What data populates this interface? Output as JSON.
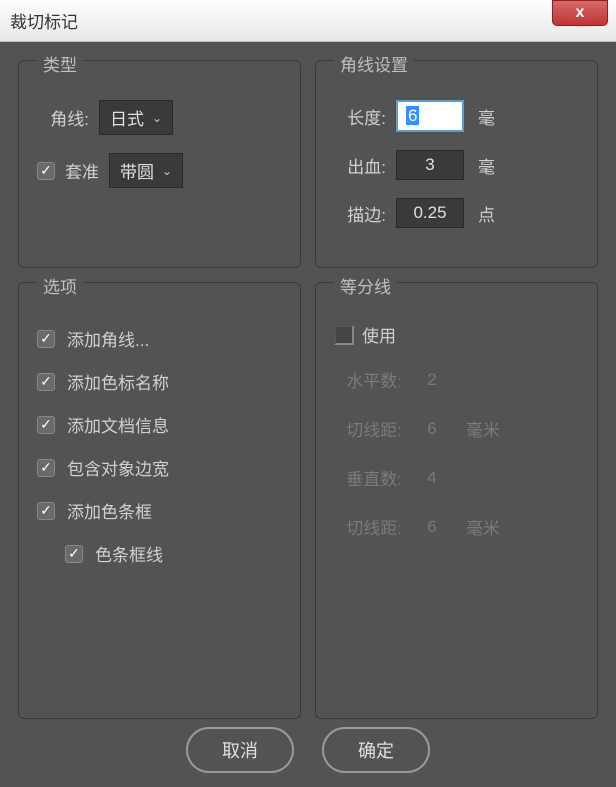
{
  "window_title": "裁切标记",
  "close_label": "x",
  "panels": {
    "type": {
      "legend": "类型",
      "corner_line_label": "角线:",
      "corner_line_value": "日式",
      "register_label": "套准",
      "register_checked": true,
      "register_value": "带圆"
    },
    "corner_settings": {
      "legend": "角线设置",
      "length_label": "长度:",
      "length_value": "6",
      "length_unit": "毫",
      "bleed_label": "出血:",
      "bleed_value": "3",
      "bleed_unit": "毫",
      "stroke_label": "描边:",
      "stroke_value": "0.25",
      "stroke_unit": "点"
    },
    "options": {
      "legend": "选项",
      "items": [
        {
          "label": "添加角线...",
          "checked": true,
          "indent": false
        },
        {
          "label": "添加色标名称",
          "checked": true,
          "indent": false
        },
        {
          "label": "添加文档信息",
          "checked": true,
          "indent": false
        },
        {
          "label": "包含对象边宽",
          "checked": true,
          "indent": false
        },
        {
          "label": "添加色条框",
          "checked": true,
          "indent": false
        },
        {
          "label": "色条框线",
          "checked": true,
          "indent": true
        }
      ]
    },
    "dividers": {
      "legend": "等分线",
      "use_label": "使用",
      "use_checked": false,
      "h_count_label": "水平数:",
      "h_count_value": "2",
      "h_dist_label": "切线距:",
      "h_dist_value": "6",
      "h_dist_unit": "毫米",
      "v_count_label": "垂直数:",
      "v_count_value": "4",
      "v_dist_label": "切线距:",
      "v_dist_value": "6",
      "v_dist_unit": "毫米"
    }
  },
  "buttons": {
    "cancel": "取消",
    "ok": "确定"
  }
}
